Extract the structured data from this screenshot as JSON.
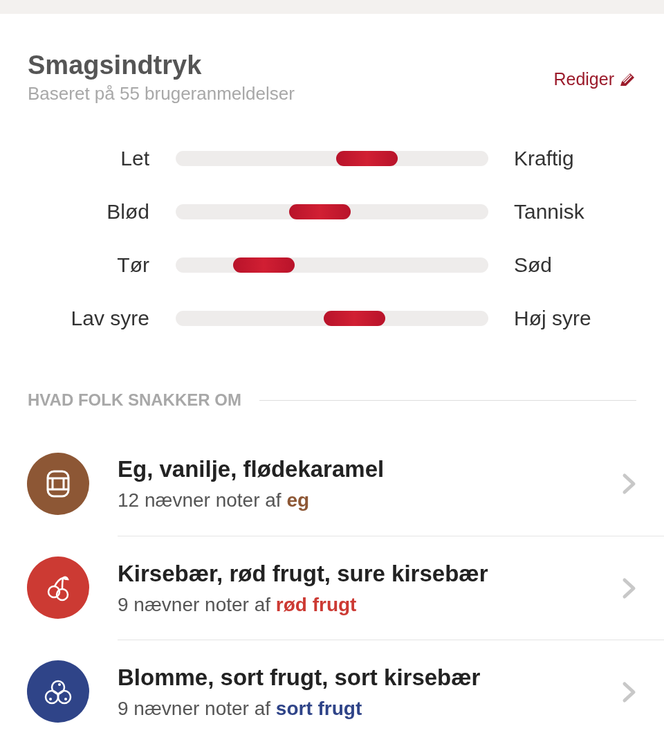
{
  "header": {
    "title": "Smagsindtryk",
    "subtitle": "Baseret på 55 brugeranmeldelser",
    "edit": "Rediger"
  },
  "scales": [
    {
      "left": "Let",
      "right": "Kraftig",
      "level": 0.61
    },
    {
      "left": "Blød",
      "right": "Tannisk",
      "level": 0.46
    },
    {
      "left": "Tør",
      "right": "Sød",
      "level": 0.28
    },
    {
      "left": "Lav syre",
      "right": "Høj syre",
      "level": 0.57
    }
  ],
  "section": {
    "title": "HVAD FOLK SNAKKER OM"
  },
  "notes": [
    {
      "kind": "barrel",
      "color": "#8d5735",
      "title": "Eg, vanilje, flødekaramel",
      "mentions": "12 nævner noter af",
      "note": "eg"
    },
    {
      "kind": "cherry",
      "color": "#cc3a33",
      "title": "Kirsebær, rød frugt, sure kirsebær",
      "mentions": "9 nævner noter af",
      "note": "rød frugt"
    },
    {
      "kind": "berries",
      "color": "#2f4488",
      "title": "Blomme, sort frugt, sort kirsebær",
      "mentions": "9 nævner noter af",
      "note": "sort frugt"
    }
  ]
}
